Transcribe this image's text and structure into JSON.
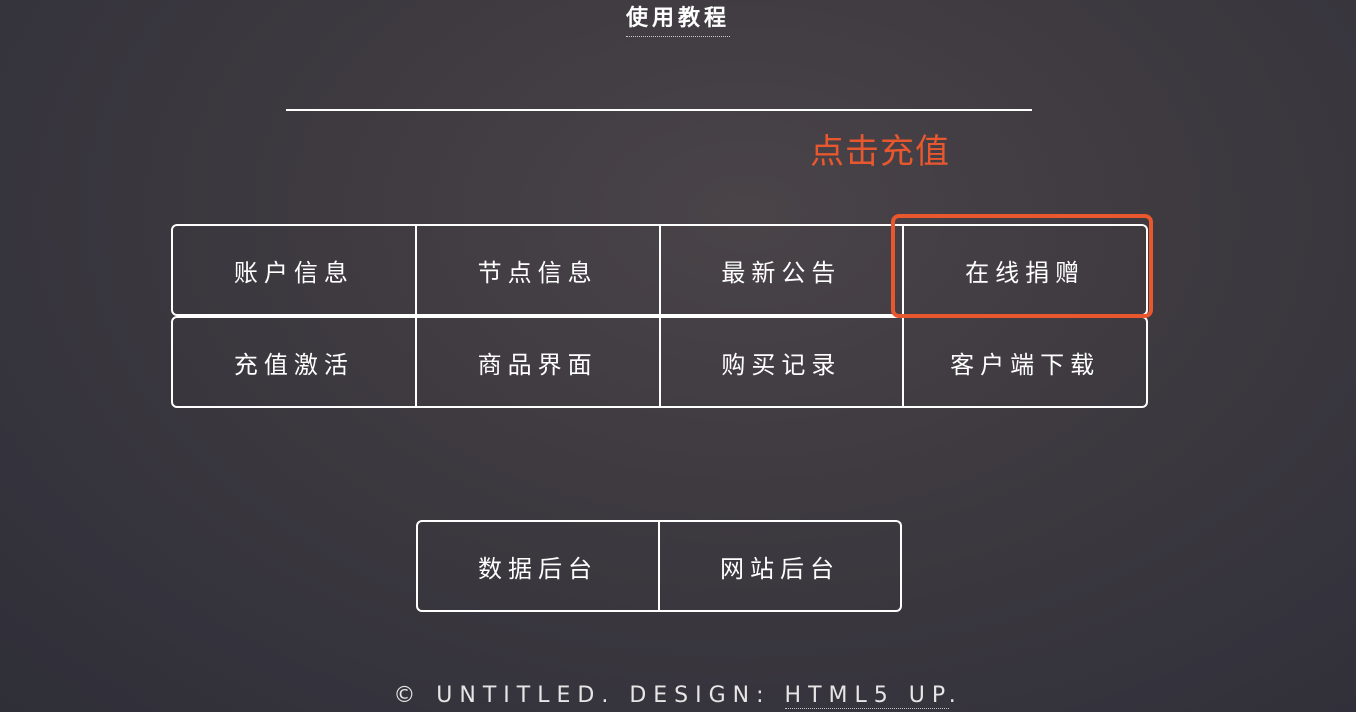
{
  "header": {
    "tutorial_link": "使用教程"
  },
  "annotation": {
    "text": "点击充值",
    "color": "#e8572e"
  },
  "nav": {
    "row1": [
      "账户信息",
      "节点信息",
      "最新公告",
      "在线捐赠"
    ],
    "row2": [
      "充值激活",
      "商品界面",
      "购买记录",
      "客户端下载"
    ]
  },
  "admin": {
    "buttons": [
      "数据后台",
      "网站后台"
    ]
  },
  "footer": {
    "prefix": "© UNTITLED. DESIGN: ",
    "link": "HTML5 UP",
    "suffix": "."
  }
}
